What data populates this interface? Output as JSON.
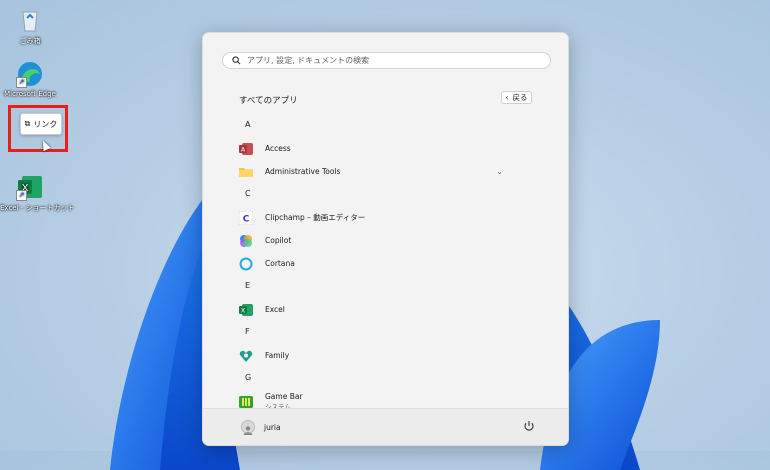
{
  "desktop": {
    "icons": [
      {
        "label": "ごみ箱",
        "icon": "recycle-bin-icon"
      },
      {
        "label": "Microsoft Edge",
        "icon": "edge-icon"
      },
      {
        "label": "Excel - ショートカット",
        "icon": "excel-icon"
      }
    ],
    "tooltip": {
      "label": "リンク",
      "icon": "link-icon"
    }
  },
  "start_menu": {
    "search_placeholder": "アプリ, 設定, ドキュメントの検索",
    "all_apps_title": "すべてのアプリ",
    "back_label": "戻る",
    "sections": [
      {
        "letter": "A",
        "apps": [
          {
            "name": "Access",
            "icon": "access-icon"
          },
          {
            "name": "Administrative Tools",
            "icon": "folder-icon",
            "expandable": true
          }
        ]
      },
      {
        "letter": "C",
        "apps": [
          {
            "name": "Clipchamp – 動画エディター",
            "icon": "clipchamp-icon"
          },
          {
            "name": "Copilot",
            "icon": "copilot-icon"
          },
          {
            "name": "Cortana",
            "icon": "cortana-icon"
          }
        ]
      },
      {
        "letter": "E",
        "apps": [
          {
            "name": "Excel",
            "icon": "excel-icon"
          }
        ]
      },
      {
        "letter": "F",
        "apps": [
          {
            "name": "Family",
            "icon": "family-icon"
          }
        ]
      },
      {
        "letter": "G",
        "apps": [
          {
            "name": "Game Bar",
            "sub": "システム",
            "icon": "game-bar-icon"
          }
        ]
      }
    ],
    "user": {
      "name": "juria"
    },
    "colors": {
      "access": "#a4373a",
      "excel": "#107c41",
      "folder": "#f4c542",
      "highlight": "#e8201a"
    }
  }
}
